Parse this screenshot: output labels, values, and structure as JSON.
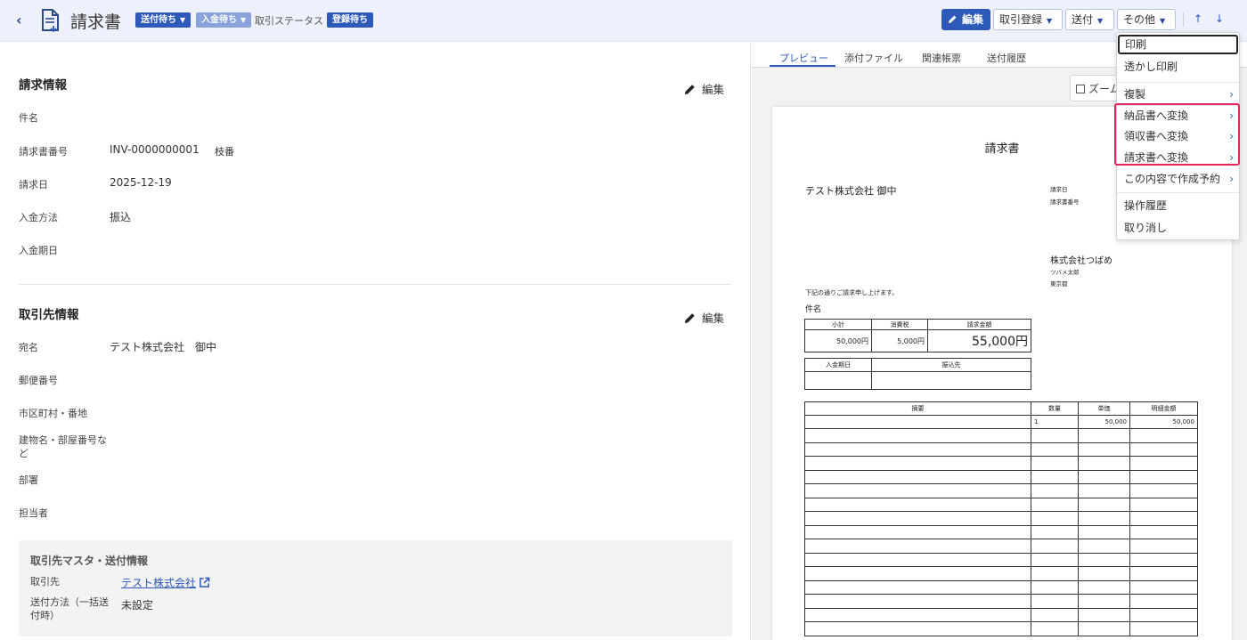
{
  "header": {
    "back": "‹",
    "title": "請求書",
    "badge_send": "送付待ち",
    "badge_payment": "入金待ち",
    "status_label": "取引ステータス",
    "badge_register": "登録待ち",
    "btn_edit": "編集",
    "btn_register": "取引登録",
    "btn_send": "送付",
    "btn_other": "その他",
    "arrow_up": "↑",
    "arrow_down": "↓"
  },
  "invoice_info": {
    "title": "請求情報",
    "edit": "編集",
    "fields": {
      "subject_label": "件名",
      "number_label": "請求書番号",
      "number_value": "INV-0000000001",
      "branch_label": "枝番",
      "date_label": "請求日",
      "date_value": "2025-12-19",
      "method_label": "入金方法",
      "method_value": "振込",
      "due_label": "入金期日"
    }
  },
  "partner_info": {
    "title": "取引先情報",
    "edit": "編集",
    "fields": {
      "addressee_label": "宛名",
      "addressee_value": "テスト株式会社　御中",
      "zip_label": "郵便番号",
      "city_label": "市区町村・番地",
      "building_label_1": "建物名・部屋番号な",
      "building_label_2": "ど",
      "dept_label": "部署",
      "person_label": "担当者"
    }
  },
  "master": {
    "title": "取引先マスタ・送付情報",
    "partner_label": "取引先",
    "partner_value": "テスト株式会社",
    "method_label_1": "送付方法（一括送",
    "method_label_2": "付時）",
    "method_value": "未設定"
  },
  "tabs": [
    "プレビュー",
    "添付ファイル",
    "関連帳票",
    "送付履歴"
  ],
  "zoom_label": "ズーム",
  "preview": {
    "title": "請求書",
    "recipient": "テスト株式会社 御中",
    "date_label": "請求日",
    "number_label": "請求書番号",
    "company": "株式会社つばめ",
    "person": "ツバメ太郎",
    "city": "東京都",
    "message": "下記の通りご請求申し上げます。",
    "subject_label": "件名",
    "summary_headers": [
      "小計",
      "消費税",
      "請求金額"
    ],
    "summary_values": [
      "50,000円",
      "5,000円",
      "55,000円"
    ],
    "pay_headers": [
      "入金期日",
      "振込先"
    ],
    "item_headers": [
      "摘要",
      "数量",
      "単価",
      "明細金額"
    ],
    "item_row": [
      "",
      "1",
      "50,000",
      "50,000"
    ]
  },
  "menu": {
    "print": "印刷",
    "watermark_print": "透かし印刷",
    "duplicate": "複製",
    "to_delivery": "納品書へ変換",
    "to_receipt": "領収書へ変換",
    "to_invoice": "請求書へ変換",
    "schedule": "この内容で作成予約",
    "history": "操作履歴",
    "cancel": "取り消し",
    "chevron": "›"
  },
  "colors": {
    "accent": "#2d59b8",
    "highlight": "#e8255a",
    "header_bg": "#eef1fb"
  }
}
